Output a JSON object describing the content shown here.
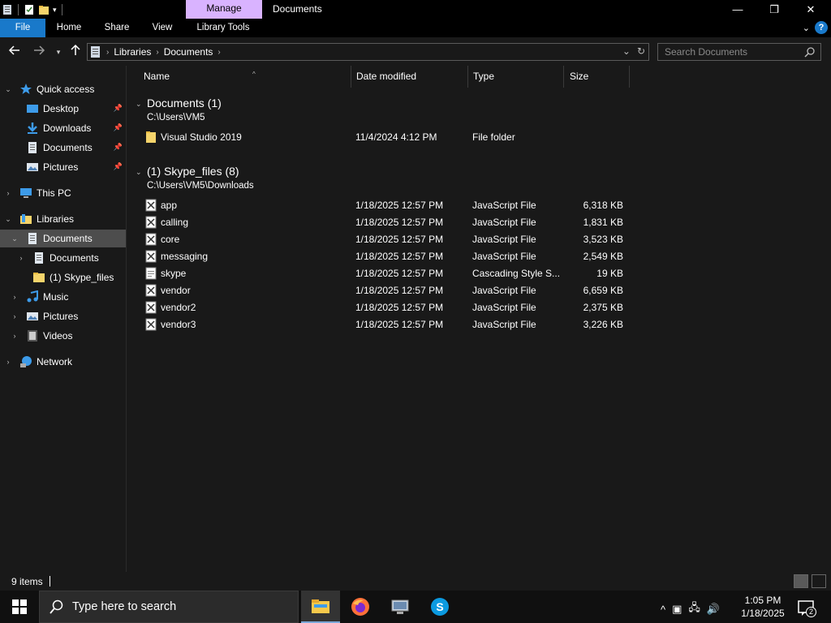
{
  "window": {
    "title": "Documents",
    "context_tab": "Manage",
    "minimize_glyph": "—",
    "maximize_glyph": "❐",
    "close_glyph": "✕"
  },
  "ribbon": {
    "tabs": [
      {
        "label": "File"
      },
      {
        "label": "Home"
      },
      {
        "label": "Share"
      },
      {
        "label": "View"
      },
      {
        "label": "Library Tools"
      }
    ],
    "help_label": "?"
  },
  "address": {
    "crumbs": [
      "Libraries",
      "Documents"
    ]
  },
  "search": {
    "placeholder": "Search Documents"
  },
  "sidebar": {
    "items": [
      {
        "label": "Quick access",
        "icon": "star-icon"
      },
      {
        "label": "Desktop",
        "icon": "desktop-icon"
      },
      {
        "label": "Downloads",
        "icon": "download-icon"
      },
      {
        "label": "Documents",
        "icon": "document-icon"
      },
      {
        "label": "Pictures",
        "icon": "pictures-icon"
      },
      {
        "label": "This PC",
        "icon": "computer-icon"
      },
      {
        "label": "Libraries",
        "icon": "library-icon"
      },
      {
        "label": "Documents",
        "icon": "document-icon"
      },
      {
        "label": "Documents",
        "icon": "document-icon"
      },
      {
        "label": "(1) Skype_files",
        "icon": "folder-icon"
      },
      {
        "label": "Music",
        "icon": "music-icon"
      },
      {
        "label": "Pictures",
        "icon": "pictures-icon"
      },
      {
        "label": "Videos",
        "icon": "video-icon"
      },
      {
        "label": "Network",
        "icon": "network-icon"
      }
    ]
  },
  "columns": {
    "name": "Name",
    "date": "Date modified",
    "type": "Type",
    "size": "Size"
  },
  "groups": [
    {
      "title": "Documents (1)",
      "path": "C:\\Users\\VM5",
      "files": [
        {
          "name": "Visual Studio 2019",
          "date": "11/4/2024 4:12 PM",
          "type": "File folder",
          "size": "",
          "icon": "folder-icon"
        }
      ]
    },
    {
      "title": "(1) Skype_files (8)",
      "path": "C:\\Users\\VM5\\Downloads",
      "files": [
        {
          "name": "app",
          "date": "1/18/2025 12:57 PM",
          "type": "JavaScript File",
          "size": "6,318 KB",
          "icon": "js-file-icon"
        },
        {
          "name": "calling",
          "date": "1/18/2025 12:57 PM",
          "type": "JavaScript File",
          "size": "1,831 KB",
          "icon": "js-file-icon"
        },
        {
          "name": "core",
          "date": "1/18/2025 12:57 PM",
          "type": "JavaScript File",
          "size": "3,523 KB",
          "icon": "js-file-icon"
        },
        {
          "name": "messaging",
          "date": "1/18/2025 12:57 PM",
          "type": "JavaScript File",
          "size": "2,549 KB",
          "icon": "js-file-icon"
        },
        {
          "name": "skype",
          "date": "1/18/2025 12:57 PM",
          "type": "Cascading Style S...",
          "size": "19 KB",
          "icon": "css-file-icon"
        },
        {
          "name": "vendor",
          "date": "1/18/2025 12:57 PM",
          "type": "JavaScript File",
          "size": "6,659 KB",
          "icon": "js-file-icon"
        },
        {
          "name": "vendor2",
          "date": "1/18/2025 12:57 PM",
          "type": "JavaScript File",
          "size": "2,375 KB",
          "icon": "js-file-icon"
        },
        {
          "name": "vendor3",
          "date": "1/18/2025 12:57 PM",
          "type": "JavaScript File",
          "size": "3,226 KB",
          "icon": "js-file-icon"
        }
      ]
    }
  ],
  "status": {
    "item_count": "9 items"
  },
  "taskbar": {
    "search_placeholder": "Type here to search",
    "apps": [
      "file-explorer-icon",
      "firefox-icon",
      "remote-desktop-icon",
      "skype-icon"
    ],
    "clock_time": "1:05 PM",
    "clock_date": "1/18/2025",
    "notification_count": "2"
  },
  "colors": {
    "accent": "#1979ca",
    "manage_tab": "#d9b3ff",
    "background": "#191919",
    "selected": "#4d4d4d"
  }
}
